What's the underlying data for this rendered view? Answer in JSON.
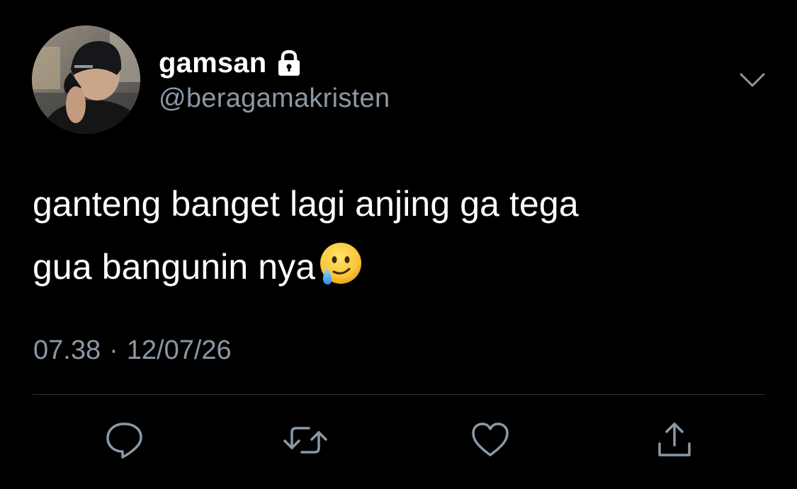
{
  "tweet": {
    "author": {
      "display_name": "gamsan",
      "handle": "@beragamakristen",
      "protected_icon": "lock-icon",
      "avatar": "profile-photo-person-in-black-cap"
    },
    "text_line1": "ganteng banget lagi anjing ga tega",
    "text_line2": "gua bangunin nya",
    "emoji": "face-holding-back-tears",
    "time": "07.38",
    "separator": "·",
    "date": "12/07/26"
  },
  "actions": [
    {
      "name": "reply",
      "icon": "comment-bubble-icon"
    },
    {
      "name": "retweet",
      "icon": "retweet-arrows-icon"
    },
    {
      "name": "like",
      "icon": "heart-icon"
    },
    {
      "name": "share",
      "icon": "share-upload-icon"
    }
  ],
  "colors": {
    "background": "#000000",
    "primary_text": "#ffffff",
    "secondary_text": "#8b98a5",
    "divider": "#2f3336"
  }
}
